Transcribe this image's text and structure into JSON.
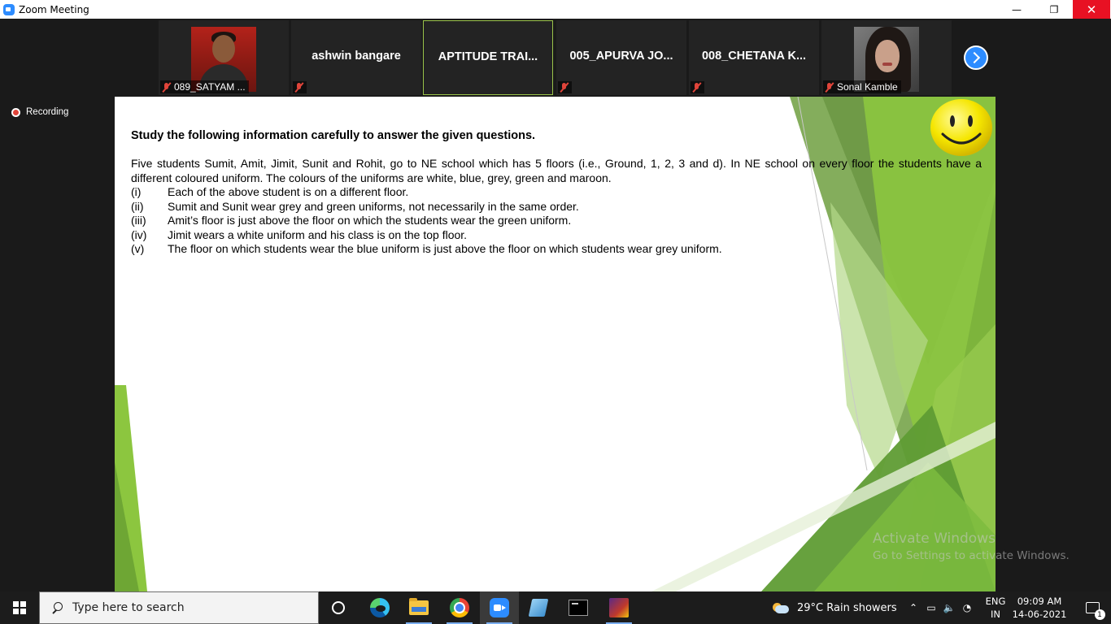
{
  "window": {
    "title": "Zoom Meeting",
    "minimize": "—",
    "restore": "❐",
    "close": "✕"
  },
  "participants": [
    {
      "label": "089_SATYAM ...",
      "type": "video",
      "mic": "muted"
    },
    {
      "name": "ashwin bangare",
      "type": "name",
      "mic": "muted"
    },
    {
      "name": "APTITUDE TRAI...",
      "type": "name",
      "active": true
    },
    {
      "name": "005_APURVA JO...",
      "type": "name",
      "mic": "muted"
    },
    {
      "name": "008_CHETANA K...",
      "type": "name",
      "mic": "muted"
    },
    {
      "label": "Sonal Kamble",
      "type": "video",
      "mic": "muted"
    }
  ],
  "recording": {
    "label": "Recording"
  },
  "slide": {
    "heading": "Study the following information carefully to answer the given questions.",
    "paragraph": "Five students Sumit, Amit, Jimit, Sunit and Rohit, go to NE school which has 5 floors (i.e., Ground, 1, 2, 3 and d). In NE school on every floor the students have a different coloured uniform. The colours of the uniforms are white, blue, grey, green and maroon.",
    "items": [
      {
        "num": "(i)",
        "text": "Each of the above student is on a different floor."
      },
      {
        "num": "(ii)",
        "text": "Sumit and Sunit wear grey and green uniforms, not necessarily in the same order."
      },
      {
        "num": "(iii)",
        "text": "Amit’s floor is just above the floor on which the students wear the green uniform."
      },
      {
        "num": "(iv)",
        "text": "Jimit wears a white uniform and his class is on the top floor."
      },
      {
        "num": "(v)",
        "text": "The floor on which students wear the blue uniform is just above the floor on which students  wear grey uniform."
      }
    ]
  },
  "watermark": {
    "line1": "Activate Windows",
    "line2": "Go to Settings to activate Windows."
  },
  "taskbar": {
    "search_placeholder": "Type here to search",
    "apps": [
      "task-view-icon",
      "edge-icon",
      "file-explorer-icon",
      "chrome-icon",
      "zoom-icon",
      "notepad-icon",
      "cmd-icon",
      "game-icon"
    ],
    "weather": "29°C  Rain showers",
    "lang_line1": "ENG",
    "lang_line2": "IN",
    "time": "09:09 AM",
    "date": "14-06-2021",
    "notification_count": "1"
  },
  "colors": {
    "zoom_blue": "#2d8cff",
    "active_border": "#9ac34a",
    "slide_green": "#8cc63f",
    "close_red": "#e81123"
  }
}
